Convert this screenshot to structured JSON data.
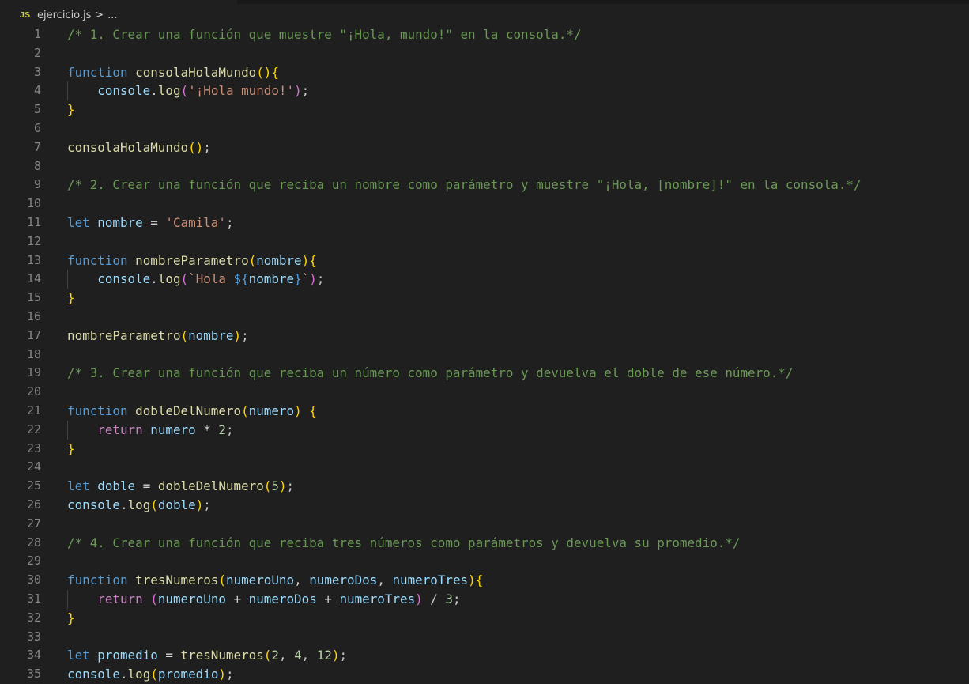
{
  "breadcrumb": {
    "file_icon": "JS",
    "file_name": "ejercicio.js",
    "separator": ">",
    "more": "..."
  },
  "editor": {
    "lines": [
      {
        "num": "1",
        "tokens": [
          {
            "t": "/* 1. Crear una función que muestre \"¡Hola, mundo!\" en la consola.*/",
            "c": "cm"
          }
        ]
      },
      {
        "num": "2",
        "tokens": []
      },
      {
        "num": "3",
        "tokens": [
          {
            "t": "function",
            "c": "kw"
          },
          {
            "t": " "
          },
          {
            "t": "consolaHolaMundo",
            "c": "fn"
          },
          {
            "t": "()",
            "c": "b1"
          },
          {
            "t": "{",
            "c": "b1"
          }
        ]
      },
      {
        "num": "4",
        "guide": true,
        "tokens": [
          {
            "t": "    "
          },
          {
            "t": "console",
            "c": "vr"
          },
          {
            "t": "."
          },
          {
            "t": "log",
            "c": "fn"
          },
          {
            "t": "(",
            "c": "b2"
          },
          {
            "t": "'¡Hola mundo!'",
            "c": "str"
          },
          {
            "t": ")",
            "c": "b2"
          },
          {
            "t": ";"
          }
        ]
      },
      {
        "num": "5",
        "tokens": [
          {
            "t": "}",
            "c": "b1"
          }
        ]
      },
      {
        "num": "6",
        "tokens": []
      },
      {
        "num": "7",
        "tokens": [
          {
            "t": "consolaHolaMundo",
            "c": "fn"
          },
          {
            "t": "()",
            "c": "b1"
          },
          {
            "t": ";"
          }
        ]
      },
      {
        "num": "8",
        "tokens": []
      },
      {
        "num": "9",
        "tokens": [
          {
            "t": "/* 2. Crear una función que reciba un nombre como parámetro y muestre \"¡Hola, [nombre]!\" en la consola.*/",
            "c": "cm"
          }
        ]
      },
      {
        "num": "10",
        "tokens": []
      },
      {
        "num": "11",
        "tokens": [
          {
            "t": "let",
            "c": "kw"
          },
          {
            "t": " "
          },
          {
            "t": "nombre",
            "c": "vr"
          },
          {
            "t": " = ",
            "c": "op"
          },
          {
            "t": "'Camila'",
            "c": "str"
          },
          {
            "t": ";"
          }
        ]
      },
      {
        "num": "12",
        "tokens": []
      },
      {
        "num": "13",
        "tokens": [
          {
            "t": "function",
            "c": "kw"
          },
          {
            "t": " "
          },
          {
            "t": "nombreParametro",
            "c": "fn"
          },
          {
            "t": "(",
            "c": "b1"
          },
          {
            "t": "nombre",
            "c": "vr"
          },
          {
            "t": ")",
            "c": "b1"
          },
          {
            "t": "{",
            "c": "b1"
          }
        ]
      },
      {
        "num": "14",
        "guide": true,
        "tokens": [
          {
            "t": "    "
          },
          {
            "t": "console",
            "c": "vr"
          },
          {
            "t": "."
          },
          {
            "t": "log",
            "c": "fn"
          },
          {
            "t": "(",
            "c": "b2"
          },
          {
            "t": "`Hola ",
            "c": "str"
          },
          {
            "t": "${",
            "c": "kw"
          },
          {
            "t": "nombre",
            "c": "vr"
          },
          {
            "t": "}",
            "c": "kw"
          },
          {
            "t": "`",
            "c": "str"
          },
          {
            "t": ")",
            "c": "b2"
          },
          {
            "t": ";"
          }
        ]
      },
      {
        "num": "15",
        "tokens": [
          {
            "t": "}",
            "c": "b1"
          }
        ]
      },
      {
        "num": "16",
        "tokens": []
      },
      {
        "num": "17",
        "tokens": [
          {
            "t": "nombreParametro",
            "c": "fn"
          },
          {
            "t": "(",
            "c": "b1"
          },
          {
            "t": "nombre",
            "c": "vr"
          },
          {
            "t": ")",
            "c": "b1"
          },
          {
            "t": ";"
          }
        ]
      },
      {
        "num": "18",
        "tokens": []
      },
      {
        "num": "19",
        "tokens": [
          {
            "t": "/* 3. Crear una función que reciba un número como parámetro y devuelva el doble de ese número.*/",
            "c": "cm"
          }
        ]
      },
      {
        "num": "20",
        "tokens": []
      },
      {
        "num": "21",
        "tokens": [
          {
            "t": "function",
            "c": "kw"
          },
          {
            "t": " "
          },
          {
            "t": "dobleDelNumero",
            "c": "fn"
          },
          {
            "t": "(",
            "c": "b1"
          },
          {
            "t": "numero",
            "c": "vr"
          },
          {
            "t": ")",
            "c": "b1"
          },
          {
            "t": " "
          },
          {
            "t": "{",
            "c": "b1"
          }
        ]
      },
      {
        "num": "22",
        "guide": true,
        "tokens": [
          {
            "t": "    "
          },
          {
            "t": "return",
            "c": "ctl"
          },
          {
            "t": " "
          },
          {
            "t": "numero",
            "c": "vr"
          },
          {
            "t": " * ",
            "c": "op"
          },
          {
            "t": "2",
            "c": "num"
          },
          {
            "t": ";"
          }
        ]
      },
      {
        "num": "23",
        "tokens": [
          {
            "t": "}",
            "c": "b1"
          }
        ]
      },
      {
        "num": "24",
        "tokens": []
      },
      {
        "num": "25",
        "tokens": [
          {
            "t": "let",
            "c": "kw"
          },
          {
            "t": " "
          },
          {
            "t": "doble",
            "c": "vr"
          },
          {
            "t": " = ",
            "c": "op"
          },
          {
            "t": "dobleDelNumero",
            "c": "fn"
          },
          {
            "t": "(",
            "c": "b1"
          },
          {
            "t": "5",
            "c": "num"
          },
          {
            "t": ")",
            "c": "b1"
          },
          {
            "t": ";"
          }
        ]
      },
      {
        "num": "26",
        "tokens": [
          {
            "t": "console",
            "c": "vr"
          },
          {
            "t": "."
          },
          {
            "t": "log",
            "c": "fn"
          },
          {
            "t": "(",
            "c": "b1"
          },
          {
            "t": "doble",
            "c": "vr"
          },
          {
            "t": ")",
            "c": "b1"
          },
          {
            "t": ";"
          }
        ]
      },
      {
        "num": "27",
        "tokens": []
      },
      {
        "num": "28",
        "tokens": [
          {
            "t": "/* 4. Crear una función que reciba tres números como parámetros y devuelva su promedio.*/",
            "c": "cm"
          }
        ]
      },
      {
        "num": "29",
        "tokens": []
      },
      {
        "num": "30",
        "tokens": [
          {
            "t": "function",
            "c": "kw"
          },
          {
            "t": " "
          },
          {
            "t": "tresNumeros",
            "c": "fn"
          },
          {
            "t": "(",
            "c": "b1"
          },
          {
            "t": "numeroUno",
            "c": "vr"
          },
          {
            "t": ", "
          },
          {
            "t": "numeroDos",
            "c": "vr"
          },
          {
            "t": ", "
          },
          {
            "t": "numeroTres",
            "c": "vr"
          },
          {
            "t": ")",
            "c": "b1"
          },
          {
            "t": "{",
            "c": "b1"
          }
        ]
      },
      {
        "num": "31",
        "guide": true,
        "tokens": [
          {
            "t": "    "
          },
          {
            "t": "return",
            "c": "ctl"
          },
          {
            "t": " "
          },
          {
            "t": "(",
            "c": "b2"
          },
          {
            "t": "numeroUno",
            "c": "vr"
          },
          {
            "t": " + ",
            "c": "op"
          },
          {
            "t": "numeroDos",
            "c": "vr"
          },
          {
            "t": " + ",
            "c": "op"
          },
          {
            "t": "numeroTres",
            "c": "vr"
          },
          {
            "t": ")",
            "c": "b2"
          },
          {
            "t": " / ",
            "c": "op"
          },
          {
            "t": "3",
            "c": "num"
          },
          {
            "t": ";"
          }
        ]
      },
      {
        "num": "32",
        "tokens": [
          {
            "t": "}",
            "c": "b1"
          }
        ]
      },
      {
        "num": "33",
        "tokens": []
      },
      {
        "num": "34",
        "tokens": [
          {
            "t": "let",
            "c": "kw"
          },
          {
            "t": " "
          },
          {
            "t": "promedio",
            "c": "vr"
          },
          {
            "t": " = ",
            "c": "op"
          },
          {
            "t": "tresNumeros",
            "c": "fn"
          },
          {
            "t": "(",
            "c": "b1"
          },
          {
            "t": "2",
            "c": "num"
          },
          {
            "t": ", "
          },
          {
            "t": "4",
            "c": "num"
          },
          {
            "t": ", "
          },
          {
            "t": "12",
            "c": "num"
          },
          {
            "t": ")",
            "c": "b1"
          },
          {
            "t": ";"
          }
        ]
      },
      {
        "num": "35",
        "tokens": [
          {
            "t": "console",
            "c": "vr"
          },
          {
            "t": "."
          },
          {
            "t": "log",
            "c": "fn"
          },
          {
            "t": "(",
            "c": "b1"
          },
          {
            "t": "promedio",
            "c": "vr"
          },
          {
            "t": ")",
            "c": "b1"
          },
          {
            "t": ";"
          }
        ]
      }
    ]
  }
}
